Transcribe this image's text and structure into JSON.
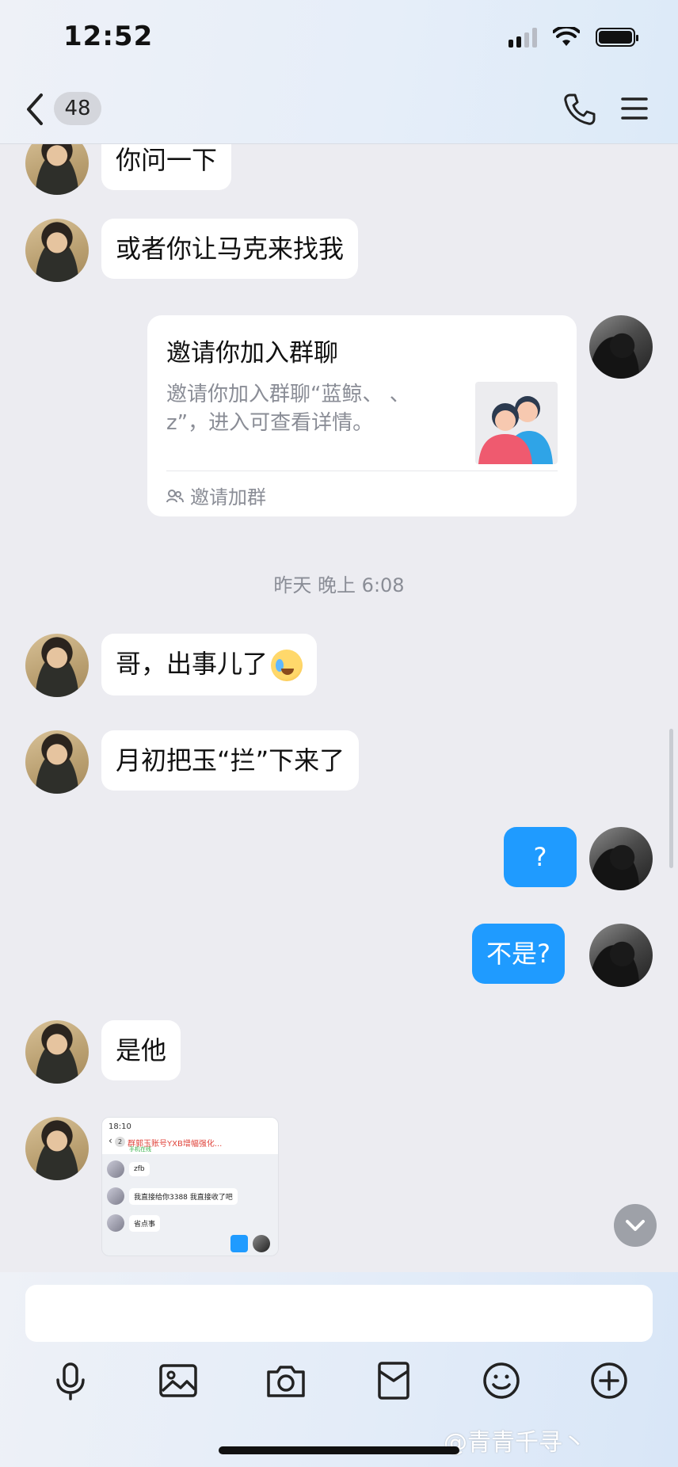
{
  "status_bar": {
    "time": "12:52"
  },
  "header": {
    "unread_count": "48"
  },
  "messages": {
    "m1": "你问一下",
    "m2": "或者你让马克来找我",
    "m4": "哥，出事儿了",
    "m5": "月初把玉“拦”下来了",
    "m6": "?",
    "m7": "不是?",
    "m8": "是他"
  },
  "invite_card": {
    "title": "邀请你加入群聊",
    "description": "邀请你加入群聊“蓝鲸、    、\nz”，进入可查看详情。",
    "footer": "邀请加群"
  },
  "timestamp": "昨天 晚上 6:08",
  "image_preview": {
    "time": "18:10",
    "badge": "2",
    "title": "群郭玉账号YXB增幅强化...",
    "subtitle": "手机在线",
    "rows": [
      "zfb",
      "我直接给你3388 我直接收了吧",
      "省点事"
    ]
  },
  "watermark": "@青青千寻丶",
  "colors": {
    "accent": "#1f9bff",
    "bubble_in": "#ffffff",
    "background": "#ececf1"
  },
  "icons": [
    "back-icon",
    "phone-icon",
    "menu-icon",
    "chevron-down-icon",
    "microphone-icon",
    "image-icon",
    "camera-icon",
    "red-packet-icon",
    "emoji-icon",
    "plus-icon"
  ]
}
